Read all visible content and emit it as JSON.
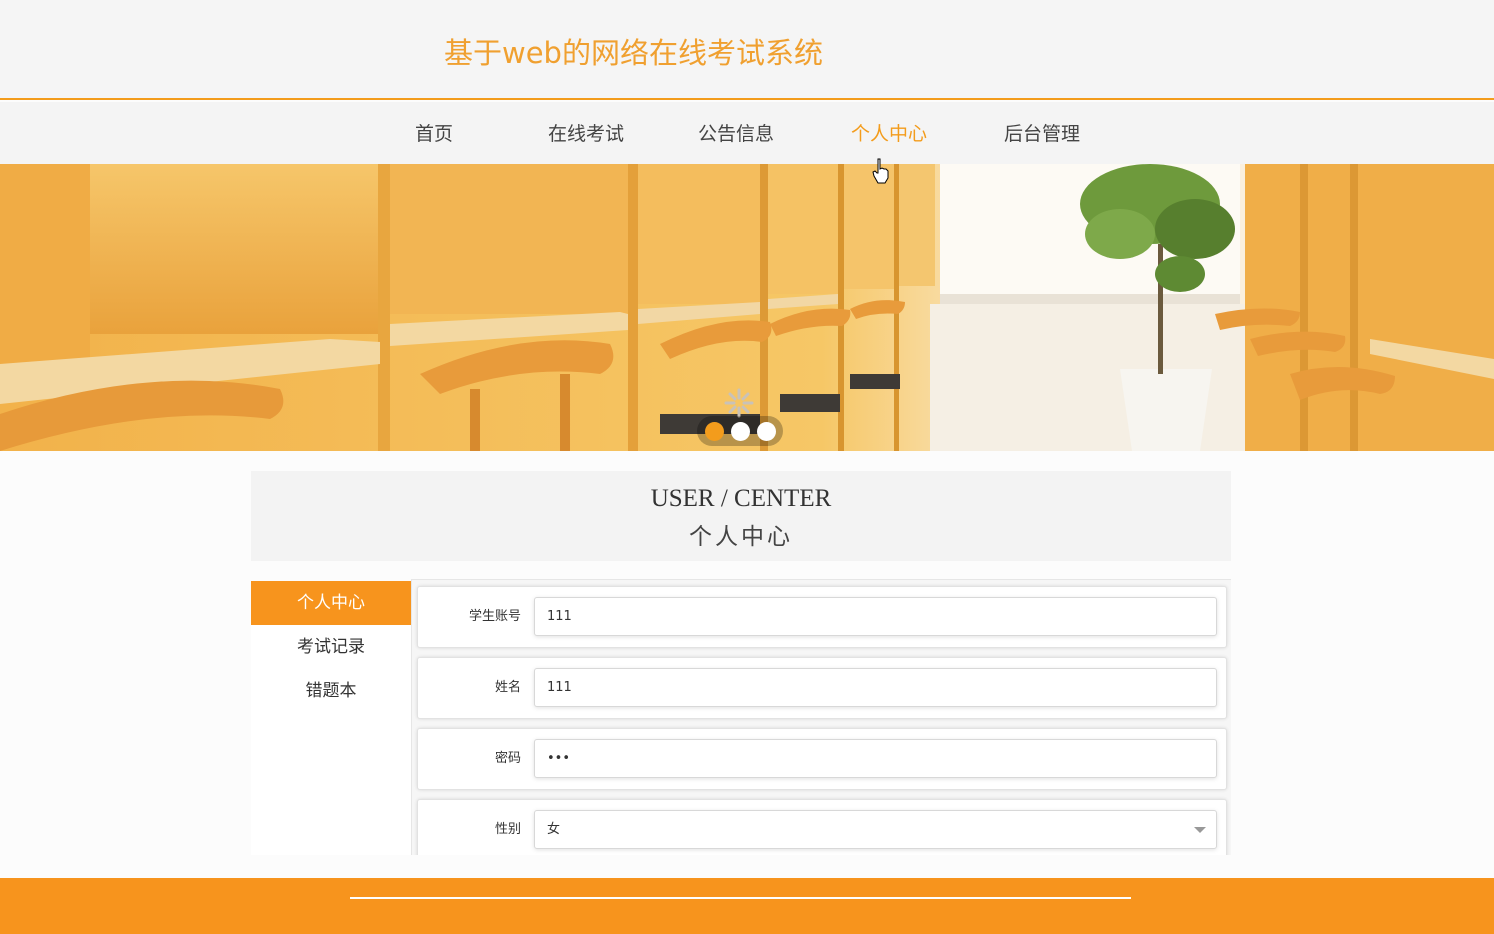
{
  "header": {
    "title": "基于web的网络在线考试系统"
  },
  "nav": {
    "items": [
      {
        "label": "首页",
        "active": false
      },
      {
        "label": "在线考试",
        "active": false
      },
      {
        "label": "公告信息",
        "active": false
      },
      {
        "label": "个人中心",
        "active": true
      },
      {
        "label": "后台管理",
        "active": false
      }
    ]
  },
  "banner": {
    "slide_count": 3,
    "active_slide": 1
  },
  "section": {
    "title_en": "USER / CENTER",
    "title_zh": "个人中心"
  },
  "sidebar": {
    "items": [
      {
        "label": "个人中心",
        "active": true
      },
      {
        "label": "考试记录",
        "active": false
      },
      {
        "label": "错题本",
        "active": false
      }
    ]
  },
  "form": {
    "fields": [
      {
        "label": "学生账号",
        "value": "111"
      },
      {
        "label": "姓名",
        "value": "111"
      },
      {
        "label": "密码",
        "value": "•••"
      },
      {
        "label": "性别",
        "value": "女"
      }
    ]
  },
  "colors": {
    "accent": "#f7941d",
    "title": "#f0a030"
  }
}
